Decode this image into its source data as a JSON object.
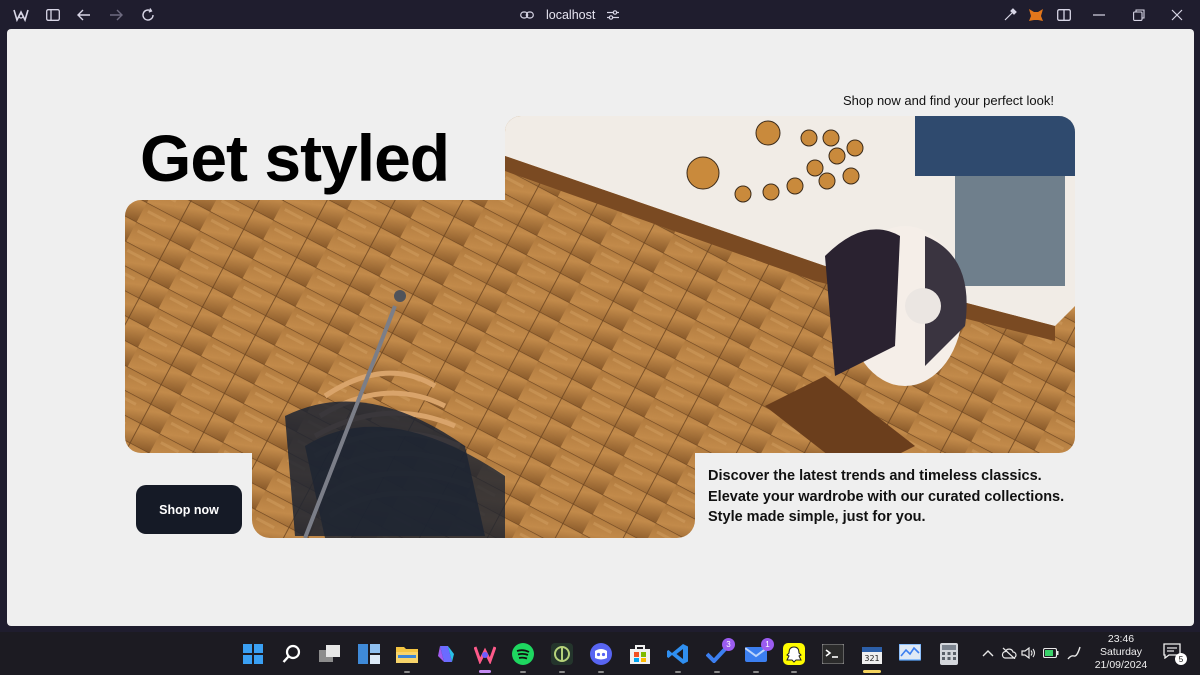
{
  "browser": {
    "url": "localhost"
  },
  "page": {
    "tagline": "Shop now and find your perfect look!",
    "hero_title": "Get styled",
    "shop_button": "Shop now",
    "description": [
      "Discover the latest trends and timeless classics.",
      "Elevate your wardrobe with our curated collections.",
      "Style made simple, just for you."
    ]
  },
  "taskbar": {
    "icons": [
      {
        "name": "windows-start-icon",
        "color": "#3aa0f3"
      },
      {
        "name": "search-icon",
        "color": "#ffffff"
      },
      {
        "name": "task-view-icon",
        "color": "#cfcfcf"
      },
      {
        "name": "widgets-icon",
        "color": "#5aa6ff"
      },
      {
        "name": "file-explorer-icon",
        "color": "#f4c542"
      },
      {
        "name": "copilot-icon",
        "color": "#6b6bff"
      },
      {
        "name": "browser-icon",
        "color": "#ff5a8a"
      },
      {
        "name": "spotify-icon",
        "color": "#1ed760"
      },
      {
        "name": "app-icon",
        "color": "#b6d27a"
      },
      {
        "name": "discord-icon",
        "color": "#5865f2"
      },
      {
        "name": "store-icon",
        "color": "#f25022"
      },
      {
        "name": "vscode-icon",
        "color": "#2f8ff0"
      },
      {
        "name": "todo-icon",
        "color": "#3c7ff0",
        "badge": "3"
      },
      {
        "name": "mail-icon",
        "color": "#7c5ce0",
        "badge": "1"
      },
      {
        "name": "snapchat-icon",
        "color": "#fffc00"
      },
      {
        "name": "terminal-icon",
        "color": "#2b2b2b"
      },
      {
        "name": "calendar-icon",
        "color": "#f0f0f0"
      },
      {
        "name": "monitor-icon",
        "color": "#5aa6ff"
      },
      {
        "name": "calculator-icon",
        "color": "#9aa0a8"
      }
    ],
    "time": "23:46",
    "day": "Saturday",
    "date": "21/09/2024",
    "notification_count": "5"
  },
  "colors": {
    "page_bg": "#efefef",
    "button_bg": "#151a26",
    "chrome_bg": "#1f1d2e"
  }
}
